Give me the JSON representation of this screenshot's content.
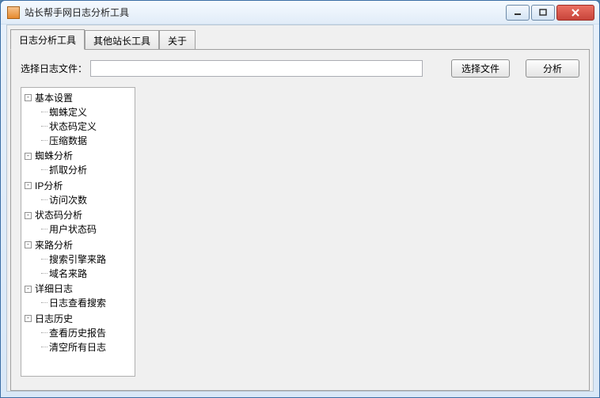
{
  "window": {
    "title": "站长帮手网日志分析工具"
  },
  "tabs": [
    {
      "label": "日志分析工具",
      "active": true
    },
    {
      "label": "其他站长工具",
      "active": false
    },
    {
      "label": "关于",
      "active": false
    }
  ],
  "filepicker": {
    "label": "选择日志文件：",
    "value": "",
    "browse_btn": "选择文件",
    "analyze_btn": "分析"
  },
  "tree": [
    {
      "label": "基本设置",
      "children": [
        {
          "label": "蜘蛛定义"
        },
        {
          "label": "状态码定义"
        },
        {
          "label": "压缩数据"
        }
      ]
    },
    {
      "label": "蜘蛛分析",
      "children": [
        {
          "label": "抓取分析"
        }
      ]
    },
    {
      "label": "IP分析",
      "children": [
        {
          "label": "访问次数"
        }
      ]
    },
    {
      "label": "状态码分析",
      "children": [
        {
          "label": "用户状态码"
        }
      ]
    },
    {
      "label": "来路分析",
      "children": [
        {
          "label": "搜索引擎来路"
        },
        {
          "label": "域名来路"
        }
      ]
    },
    {
      "label": "详细日志",
      "children": [
        {
          "label": "日志查看搜索"
        }
      ]
    },
    {
      "label": "日志历史",
      "children": [
        {
          "label": "查看历史报告"
        },
        {
          "label": "清空所有日志"
        }
      ]
    }
  ]
}
